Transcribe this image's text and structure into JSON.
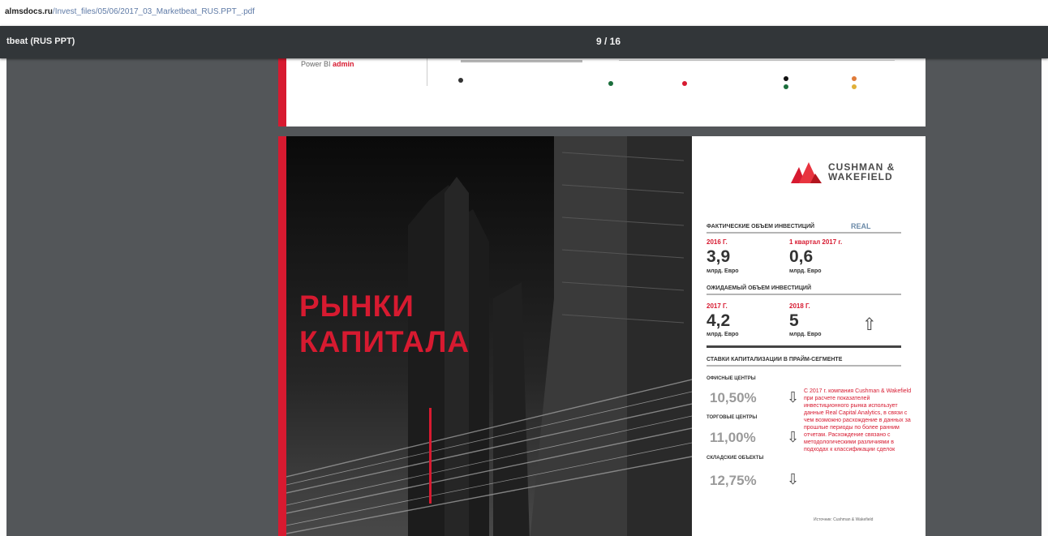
{
  "browser": {
    "url_host": "almsdocs.ru",
    "url_path": "/Invest_files/05/06/2017_03_Marketbeat_RUS.PPT_.pdf"
  },
  "toolbar": {
    "title": "tbeat (RUS PPT)",
    "page_indicator": "9 / 16"
  },
  "prev_page": {
    "power_bi_label": "Power BI",
    "power_bi_link": "admin"
  },
  "page": {
    "headline_line1": "РЫНКИ",
    "headline_line2": "КАПИТАЛА",
    "logo_line1": "CUSHMAN &",
    "logo_line2": "WAKEFIELD",
    "actual_title": "ФАКТИЧЕСКИЕ ОБЪЕМ ИНВЕСТИЦИЙ",
    "actual_badge": "REAL",
    "actual": [
      {
        "year": "2016 Г.",
        "value": "3,9",
        "unit": "млрд. Евро"
      },
      {
        "year": "1 квартал 2017 г.",
        "value": "0,6",
        "unit": "млрд. Евро"
      }
    ],
    "expected_title": "ОЖИДАЕМЫЙ ОБЪЕМ ИНВЕСТИЦИЙ",
    "expected": [
      {
        "year": "2017 Г.",
        "value": "4,2",
        "unit": "млрд. Евро"
      },
      {
        "year": "2018 Г.",
        "value": "5",
        "unit": "млрд. Евро"
      }
    ],
    "cap_title": "СТАВКИ КАПИТАЛИЗАЦИИ В ПРАЙМ-СЕГМЕНТЕ",
    "cap_rates": [
      {
        "label": "ОФИСНЫЕ ЦЕНТРЫ",
        "value": "10,50%"
      },
      {
        "label": "ТОРГОВЫЕ ЦЕНТРЫ",
        "value": "11,00%"
      },
      {
        "label": "СКЛАДСКИЕ ОБЪЕКТЫ",
        "value": "12,75%"
      }
    ],
    "note": "С 2017 г. компания Cushman & Wakefield при расчете показателей инвестиционного рынка использует данные Real Capital Analytics, в связи с чем возможно расхождение в данных за прошлые периоды по более ранним отчетам. Расхождение связано с методологическими различиями в подходах к классификации сделок",
    "footnote": "Источник: Cushman & Wakefield"
  },
  "colors": {
    "brand_red": "#d71a30",
    "toolbar": "#323639",
    "viewer_bg": "#535659"
  }
}
